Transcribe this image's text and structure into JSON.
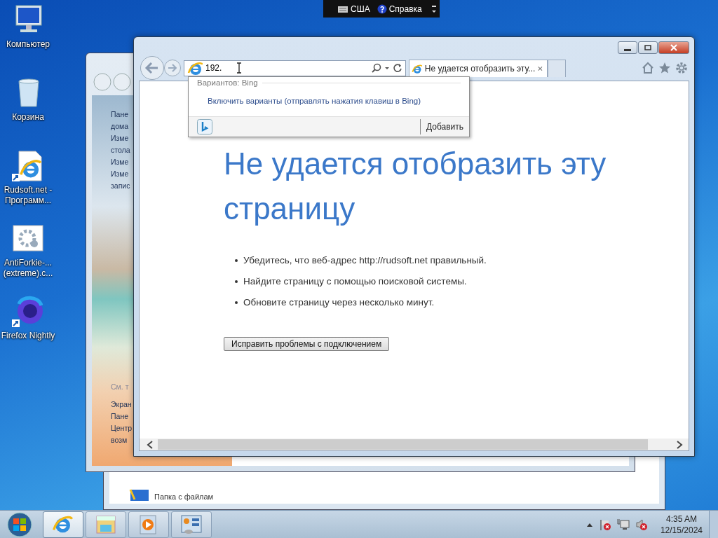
{
  "language_bar": {
    "language": "США",
    "help": "Справка"
  },
  "desktop_icons": [
    {
      "kind": "computer",
      "label": "Компьютер"
    },
    {
      "kind": "bin",
      "label": "Корзина"
    },
    {
      "kind": "ie-shortcut",
      "label": "Rudsoft.net - Программ..."
    },
    {
      "kind": "gear-file",
      "label": "AntiForkie-... (extreme).c..."
    },
    {
      "kind": "firefox",
      "label": "Firefox Nightly"
    }
  ],
  "back_window": {
    "item": "Папка с файлам"
  },
  "control_panel": {
    "links_top": [
      "Пане",
      "дома",
      "Изме",
      "стола",
      "Изме",
      "Изме",
      "запис"
    ],
    "see_also": "См. т",
    "links_bottom": [
      "Экран",
      "Пане",
      "Центр",
      "возм"
    ]
  },
  "browser": {
    "address": {
      "value": "192."
    },
    "tabs": [
      {
        "label": "Не удается отобразить эту...",
        "selected": true
      }
    ],
    "suggestions": {
      "header": "Вариантов: Bing",
      "link": "Включить варианты (отправлять нажатия клавиш в Bing)",
      "add": "Добавить"
    },
    "page": {
      "heading": "Не удается отобразить эту страницу",
      "bullets": [
        "Убедитесь, что веб-адрес http://rudsoft.net правильный.",
        "Найдите страницу с помощью поисковой системы.",
        "Обновите страницу через несколько минут."
      ],
      "button": "Исправить проблемы с подключением"
    }
  },
  "taskbar": {
    "apps": [
      {
        "kind": "ie",
        "selected": true
      },
      {
        "kind": "explorer",
        "selected": false
      },
      {
        "kind": "media",
        "selected": false
      },
      {
        "kind": "control",
        "selected": false
      }
    ],
    "clock": {
      "time": "4:35 AM",
      "date": "12/15/2024"
    }
  }
}
